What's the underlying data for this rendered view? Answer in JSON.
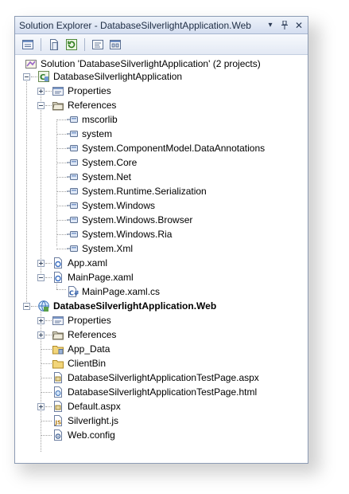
{
  "window": {
    "title": "Solution Explorer - DatabaseSilverlightApplication.Web",
    "title_buttons": [
      "dropdown-arrow-icon",
      "pin-icon",
      "close-icon"
    ]
  },
  "toolbar": {
    "tools": [
      "properties-icon",
      "show-all-files-icon",
      "refresh-icon",
      "view-code-icon",
      "view-designer-icon"
    ]
  },
  "colors": {
    "accent": "#d4def0",
    "border": "#8c9bb4"
  },
  "tree": {
    "solution": {
      "label": "Solution 'DatabaseSilverlightApplication' (2 projects)",
      "icon": "solution-icon"
    },
    "project1": {
      "label": "DatabaseSilverlightApplication",
      "icon": "silverlight-project-icon",
      "properties": "Properties",
      "references": "References",
      "reference_items": [
        "mscorlib",
        "system",
        "System.ComponentModel.DataAnnotations",
        "System.Core",
        "System.Net",
        "System.Runtime.Serialization",
        "System.Windows",
        "System.Windows.Browser",
        "System.Windows.Ria",
        "System.Xml"
      ],
      "app_xaml": "App.xaml",
      "mainpage_xaml": "MainPage.xaml",
      "mainpage_cs": "MainPage.xaml.cs"
    },
    "project2": {
      "label": "DatabaseSilverlightApplication.Web",
      "icon": "web-project-icon",
      "properties": "Properties",
      "references": "References",
      "app_data": "App_Data",
      "clientbin": "ClientBin",
      "testpage_aspx": "DatabaseSilverlightApplicationTestPage.aspx",
      "testpage_html": "DatabaseSilverlightApplicationTestPage.html",
      "default_aspx": "Default.aspx",
      "silverlight_js": "Silverlight.js",
      "web_config": "Web.config"
    }
  }
}
